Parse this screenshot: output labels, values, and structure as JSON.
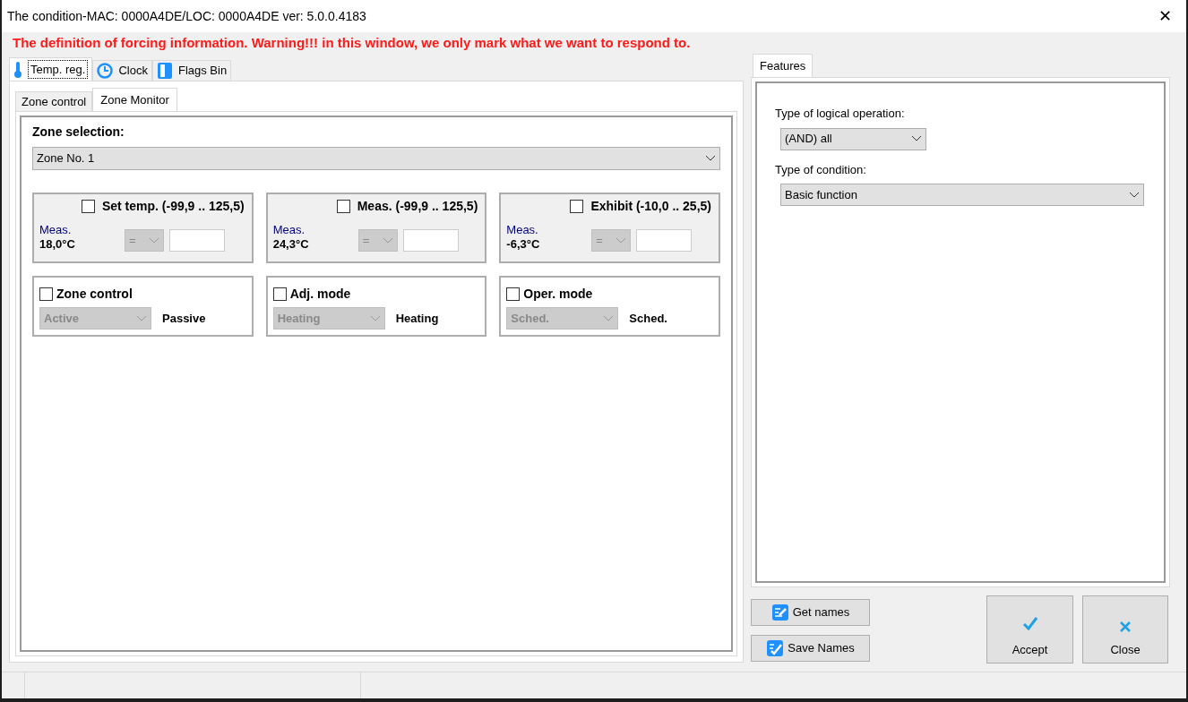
{
  "window": {
    "title": "The condition-MAC: 0000A4DE/LOC: 0000A4DE ver: 5.0.0.4183",
    "close": "✕"
  },
  "warning": "The definition of forcing information. Warning!!! in this window, we only mark what we want to respond to.",
  "tabs": [
    {
      "label": "Temp. reg.",
      "kind": "temperature",
      "selected": true
    },
    {
      "label": "Clock",
      "kind": "time",
      "selected": false
    },
    {
      "label": "Flags Bin",
      "kind": "flags",
      "selected": false
    }
  ],
  "subtabs": [
    {
      "label": "Zone control",
      "selected": false
    },
    {
      "label": "Zone Monitor",
      "selected": true
    }
  ],
  "zone_selection": {
    "label": "Zone selection:",
    "value": "Zone No. 1"
  },
  "range_cards": [
    {
      "title": "Set temp. (-99,9 .. 125,5)",
      "checked": false,
      "meas_label": "Meas.",
      "meas_value": "18,0°C",
      "operator": "="
    },
    {
      "title": "Meas. (-99,9 .. 125,5)",
      "checked": false,
      "meas_label": "Meas.",
      "meas_value": "24,3°C",
      "operator": "="
    },
    {
      "title": "Exhibit (-10,0 .. 25,5)",
      "checked": false,
      "meas_label": "Meas.",
      "meas_value": "-6,3°C",
      "operator": "="
    }
  ],
  "mode_cards": [
    {
      "title": "Zone control",
      "checked": false,
      "select": "Active",
      "current": "Passive"
    },
    {
      "title": "Adj. mode",
      "checked": false,
      "select": "Heating",
      "current": "Heating"
    },
    {
      "title": "Oper. mode",
      "checked": false,
      "select": "Sched.",
      "current": "Sched."
    }
  ],
  "features": {
    "tab": "Features",
    "logic_label": "Type of logical operation:",
    "logic_value": "(AND) all",
    "condition_label": "Type of condition:",
    "condition_value": "Basic function"
  },
  "buttons": [
    {
      "label": "Get names",
      "kind": "get"
    },
    {
      "label": "Save Names",
      "kind": "save"
    }
  ],
  "dialog_buttons": [
    {
      "label": "Accept",
      "kind": "accept"
    },
    {
      "label": "Close",
      "kind": "close"
    }
  ]
}
